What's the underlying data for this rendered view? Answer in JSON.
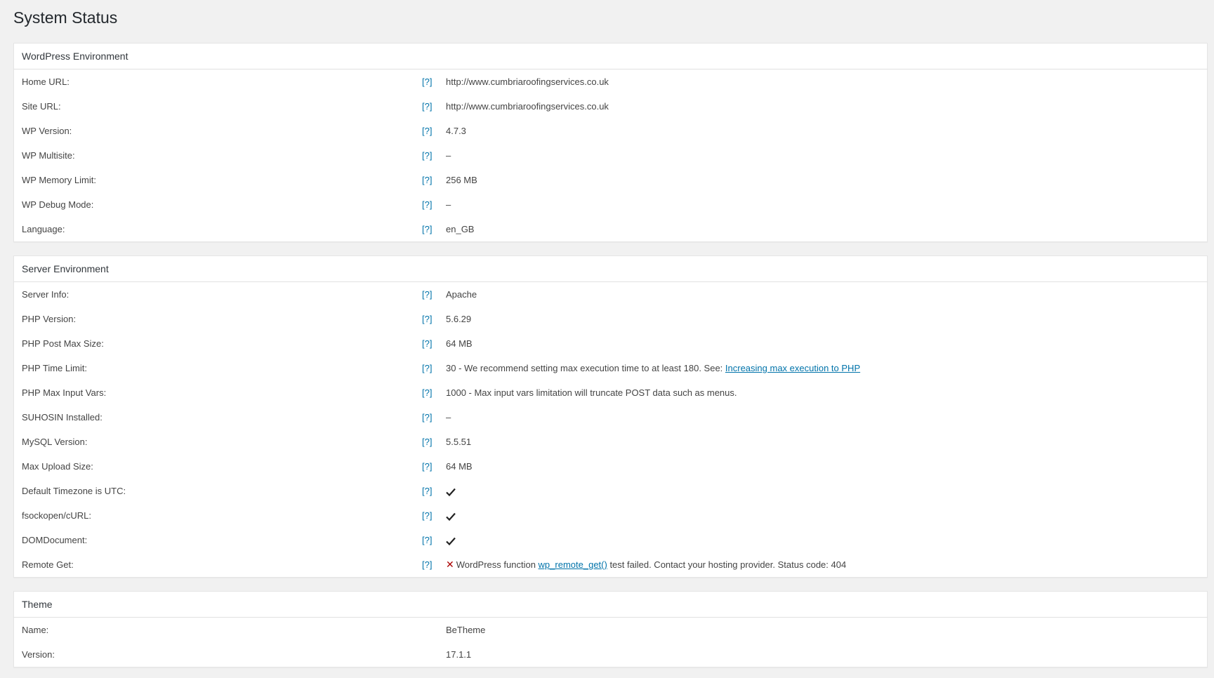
{
  "page": {
    "title": "System Status"
  },
  "help_marker": "[?]",
  "wordpress": {
    "heading": "WordPress Environment",
    "rows": [
      {
        "label": "Home URL:",
        "value": "http://www.cumbriaroofingservices.co.uk"
      },
      {
        "label": "Site URL:",
        "value": "http://www.cumbriaroofingservices.co.uk"
      },
      {
        "label": "WP Version:",
        "value": "4.7.3"
      },
      {
        "label": "WP Multisite:",
        "value": "–"
      },
      {
        "label": "WP Memory Limit:",
        "value": "256 MB"
      },
      {
        "label": "WP Debug Mode:",
        "value": "–"
      },
      {
        "label": "Language:",
        "value": "en_GB"
      }
    ]
  },
  "server": {
    "heading": "Server Environment",
    "rows": [
      {
        "label": "Server Info:",
        "value": "Apache"
      },
      {
        "label": "PHP Version:",
        "value": "5.6.29"
      },
      {
        "label": "PHP Post Max Size:",
        "value": "64 MB"
      },
      {
        "label": "PHP Time Limit:",
        "value": "30 - We recommend setting max execution time to at least 180. See: ",
        "link": "Increasing max execution to PHP"
      },
      {
        "label": "PHP Max Input Vars:",
        "value": "1000 - Max input vars limitation will truncate POST data such as menus."
      },
      {
        "label": "SUHOSIN Installed:",
        "value": "–"
      },
      {
        "label": "MySQL Version:",
        "value": "5.5.51"
      },
      {
        "label": "Max Upload Size:",
        "value": "64 MB"
      },
      {
        "label": "Default Timezone is UTC:",
        "icon": "check-icon"
      },
      {
        "label": "fsockopen/cURL:",
        "icon": "check-icon"
      },
      {
        "label": "DOMDocument:",
        "icon": "check-icon"
      },
      {
        "label": "Remote Get:",
        "icon": "x-icon",
        "symbol": "✕",
        "value_before": "WordPress function ",
        "link": "wp_remote_get()",
        "value_after": " test failed. Contact your hosting provider. Status code: 404"
      }
    ]
  },
  "theme": {
    "heading": "Theme",
    "rows": [
      {
        "label": "Name:",
        "value": "BeTheme"
      },
      {
        "label": "Version:",
        "value": "17.1.1"
      }
    ]
  },
  "colors": {
    "ok": "#5b9a2b",
    "error": "#aa0000",
    "link": "#0073aa"
  }
}
